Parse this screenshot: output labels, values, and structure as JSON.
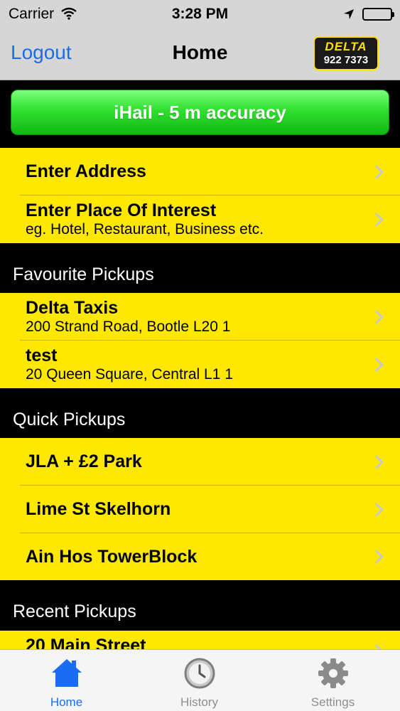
{
  "status_bar": {
    "carrier": "Carrier",
    "time": "3:28 PM"
  },
  "nav": {
    "logout_label": "Logout",
    "title": "Home",
    "logo_brand": "DELTA",
    "logo_phone": "922 7373"
  },
  "ihail_label": "iHail - 5 m accuracy",
  "address_cells": {
    "enter_address": "Enter Address",
    "enter_poi_title": "Enter Place Of Interest",
    "enter_poi_subtitle": "eg. Hotel, Restaurant, Business etc."
  },
  "favourites": {
    "header": "Favourite Pickups",
    "items": [
      {
        "title": "Delta Taxis",
        "subtitle": "200 Strand Road, Bootle L20 1"
      },
      {
        "title": "test",
        "subtitle": "20 Queen Square, Central L1 1"
      }
    ]
  },
  "quick": {
    "header": "Quick Pickups",
    "items": [
      {
        "title": "JLA + £2 Park"
      },
      {
        "title": "Lime St Skelhorn"
      },
      {
        "title": "Ain Hos TowerBlock"
      }
    ]
  },
  "recent": {
    "header": "Recent Pickups",
    "items": [
      {
        "title": "20 Main Street"
      }
    ]
  },
  "tabs": [
    {
      "label": "Home",
      "icon": "house-icon",
      "active": true
    },
    {
      "label": "History",
      "icon": "clock-icon",
      "active": false
    },
    {
      "label": "Settings",
      "icon": "gear-icon",
      "active": false
    }
  ],
  "colors": {
    "cell_yellow": "#ffe800",
    "accent_blue": "#1a6cf0",
    "ihail_green": "#2fe02f"
  }
}
